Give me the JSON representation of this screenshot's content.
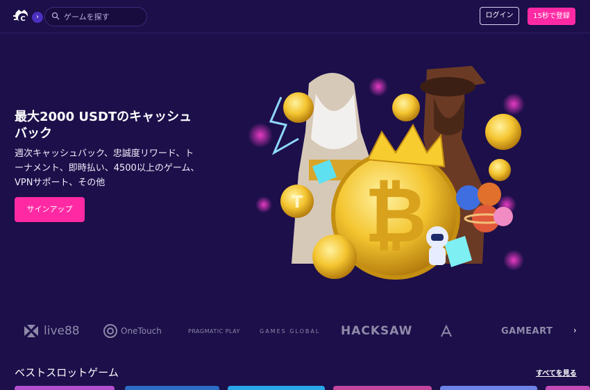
{
  "header": {
    "search_placeholder": "ゲームを探す",
    "login_label": "ログイン",
    "register_label": "15秒で登録"
  },
  "hero": {
    "title": "最大2000 USDTのキャッシュバック",
    "subtitle": "週次キャッシュバック、忠誠度リワード、トーナメント、即時払い、4500以上のゲーム、VPNサポート、その他",
    "signup_label": "サインアップ"
  },
  "providers": [
    "live88",
    "OneTouch",
    "PRAGMATIC PLAY",
    "GAMES GLOBAL",
    "HACKSAW",
    "GAMEART"
  ],
  "section": {
    "title": "ベストスロットゲーム",
    "see_all": "すべてを見る"
  },
  "colors": {
    "background": "#1c0f4a",
    "accent_pink": "#ff2aa3",
    "provider_gray": "#8f8aa9"
  },
  "icons": {
    "logo": "cat-logo-icon",
    "search": "search-icon",
    "expand": "chevron-right-icon",
    "next": "chevron-right-icon"
  }
}
